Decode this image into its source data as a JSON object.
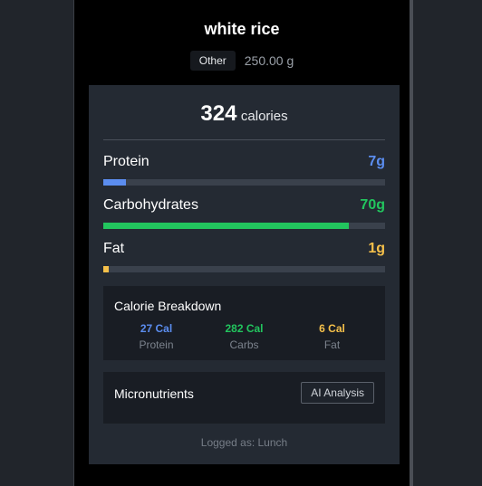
{
  "food": {
    "title": "white rice",
    "category": "Other",
    "weight": "250.00 g"
  },
  "summary": {
    "calories": "324",
    "calories_unit": "calories"
  },
  "macros": [
    {
      "name": "Protein",
      "value": "7g",
      "color": "#5b8def",
      "fill_percent": 8
    },
    {
      "name": "Carbohydrates",
      "value": "70g",
      "color": "#22c55e",
      "fill_percent": 87
    },
    {
      "name": "Fat",
      "value": "1g",
      "color": "#f5c04a",
      "fill_percent": 2
    }
  ],
  "breakdown": {
    "title": "Calorie Breakdown",
    "items": [
      {
        "value": "27 Cal",
        "label": "Protein",
        "color": "#5b8def"
      },
      {
        "value": "282 Cal",
        "label": "Carbs",
        "color": "#22c55e"
      },
      {
        "value": "6 Cal",
        "label": "Fat",
        "color": "#f5c04a"
      }
    ]
  },
  "micronutrients": {
    "title": "Micronutrients",
    "button_label": "AI Analysis"
  },
  "footer": {
    "logged": "Logged as: Lunch"
  }
}
